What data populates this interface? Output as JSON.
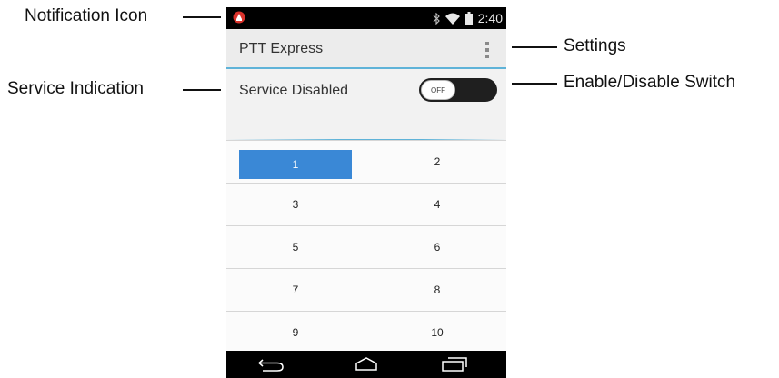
{
  "callouts": {
    "notification_icon": "Notification Icon",
    "service_indication": "Service Indication",
    "settings": "Settings",
    "enable_disable_switch": "Enable/Disable Switch"
  },
  "status_bar": {
    "time": "2:40",
    "icons": [
      "bluetooth-icon",
      "wifi-icon",
      "battery-icon"
    ],
    "notification_icon": "ptt-notification-icon",
    "notification_color": "#d9322b"
  },
  "app": {
    "title": "PTT Express",
    "overflow_icon": "overflow-menu-icon",
    "accent_color": "#5fb3d8"
  },
  "service": {
    "status_text": "Service Disabled",
    "switch_label": "OFF"
  },
  "grid": {
    "selected": "1",
    "selected_color": "#3a88d6",
    "rows": [
      [
        "1",
        "2"
      ],
      [
        "3",
        "4"
      ],
      [
        "5",
        "6"
      ],
      [
        "7",
        "8"
      ],
      [
        "9",
        "10"
      ]
    ]
  },
  "nav_bar": {
    "icons": [
      "back-icon",
      "home-icon",
      "recents-icon"
    ]
  }
}
